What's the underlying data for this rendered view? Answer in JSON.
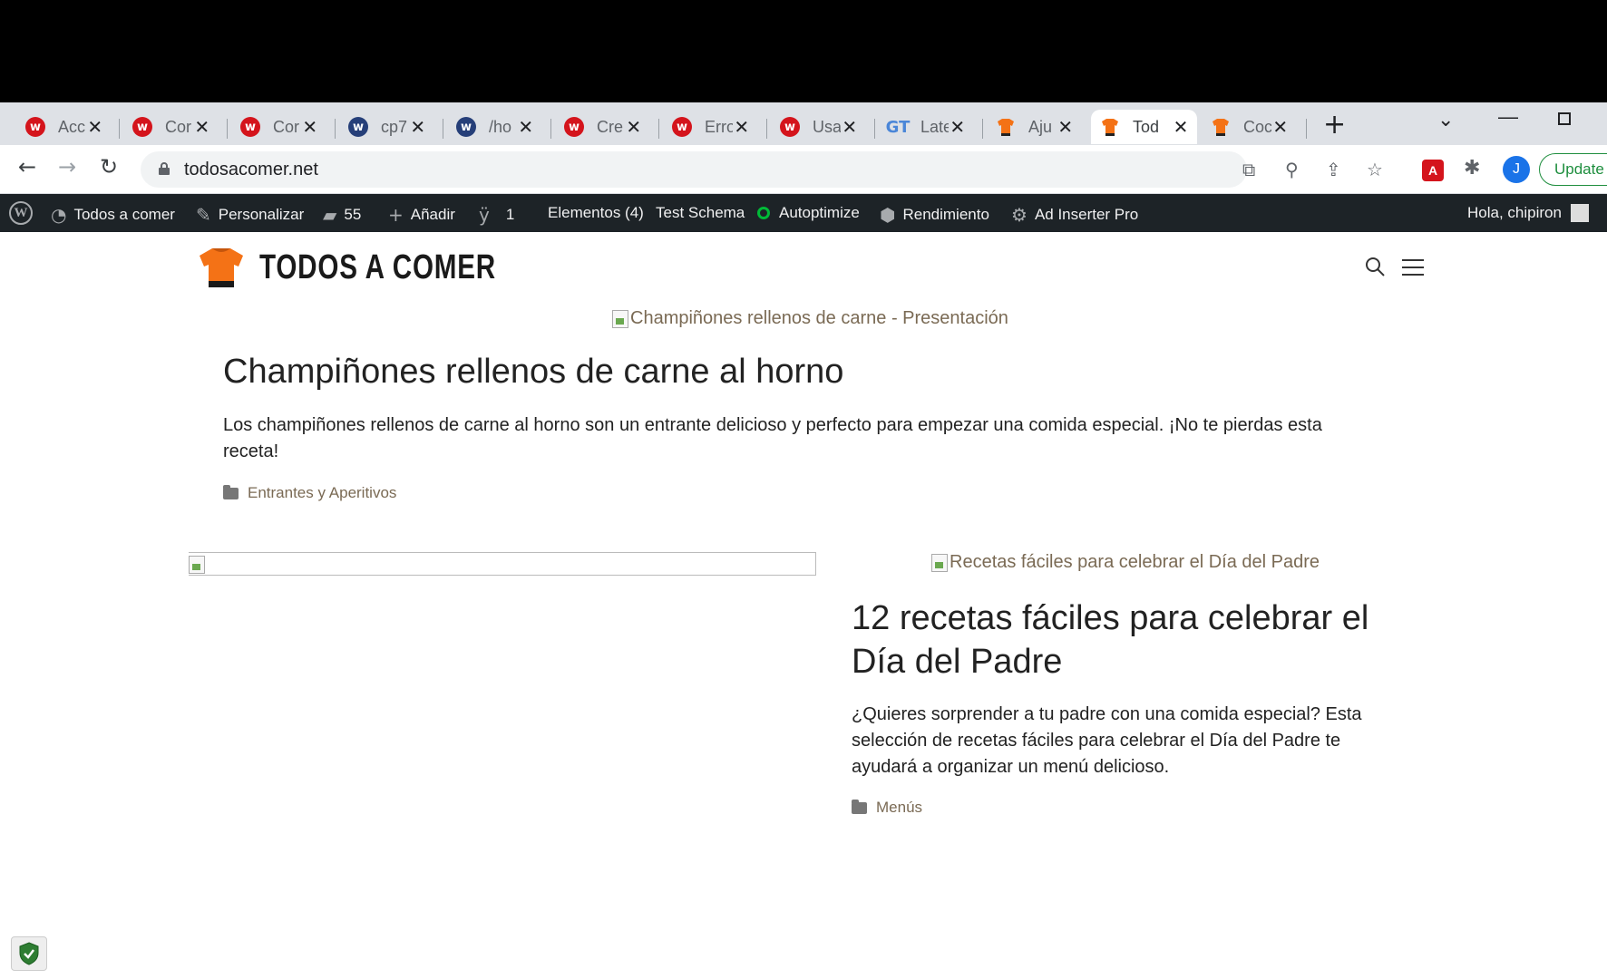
{
  "browser": {
    "tabs": [
      {
        "title": "Acc",
        "favicon": "w-red-icon"
      },
      {
        "title": "Cor",
        "favicon": "w-red-circle-icon"
      },
      {
        "title": "Cor",
        "favicon": "w-red-circle-icon"
      },
      {
        "title": "cp7",
        "favicon": "w-blue-circle-icon"
      },
      {
        "title": "/ho",
        "favicon": "w-blue-circle-icon"
      },
      {
        "title": "Cre",
        "favicon": "w-red-icon"
      },
      {
        "title": "Erro",
        "favicon": "w-red-circle-icon"
      },
      {
        "title": "Usa",
        "favicon": "w-red-circle-icon"
      },
      {
        "title": "Late",
        "favicon": "gt-icon"
      },
      {
        "title": "Aju",
        "favicon": "shirt-icon"
      },
      {
        "title": "Tod",
        "favicon": "shirt-icon",
        "active": true
      },
      {
        "title": "Coc",
        "favicon": "shirt-icon"
      }
    ],
    "favicon_letters": {
      "w": "w",
      "gt": "GT"
    },
    "url": "todosacomer.net",
    "update_label": "Update",
    "profile_initial": "J",
    "pdf_label": "A"
  },
  "adminbar": {
    "site_name": "Todos a comer",
    "customize": "Personalizar",
    "comments_count": "55",
    "add_new": "Añadir",
    "yoast_count": "1",
    "elements": "Elementos (4)",
    "test_schema": "Test Schema",
    "autoptimize": "Autoptimize",
    "performance": "Rendimiento",
    "ad_inserter": "Ad Inserter Pro",
    "greeting": "Hola, chipiron"
  },
  "site": {
    "logo_text": "TODOS A COMER"
  },
  "posts": [
    {
      "image_alt": "Champiñones rellenos de carne - Presentación",
      "title": "Champiñones rellenos de carne al horno",
      "excerpt": "Los champiñones rellenos de carne al horno son un entrante delicioso y perfecto para empezar una comida especial. ¡No te pierdas esta receta!",
      "category": "Entrantes y Aperitivos"
    },
    {
      "image_alt": "Recetas fáciles para celebrar el Día del Padre",
      "title": "12 recetas fáciles para celebrar el Día del Padre",
      "excerpt": "¿Quieres sorprender a tu padre con una comida especial? Esta selección de recetas fáciles para celebrar el Día del Padre te ayudará a organizar un menú delicioso.",
      "category": "Menús"
    }
  ],
  "colors": {
    "accent_orange": "#f47216",
    "link_brown": "#7a6a54",
    "adminbar_bg": "#1d2327",
    "update_green": "#1e8e3e"
  }
}
